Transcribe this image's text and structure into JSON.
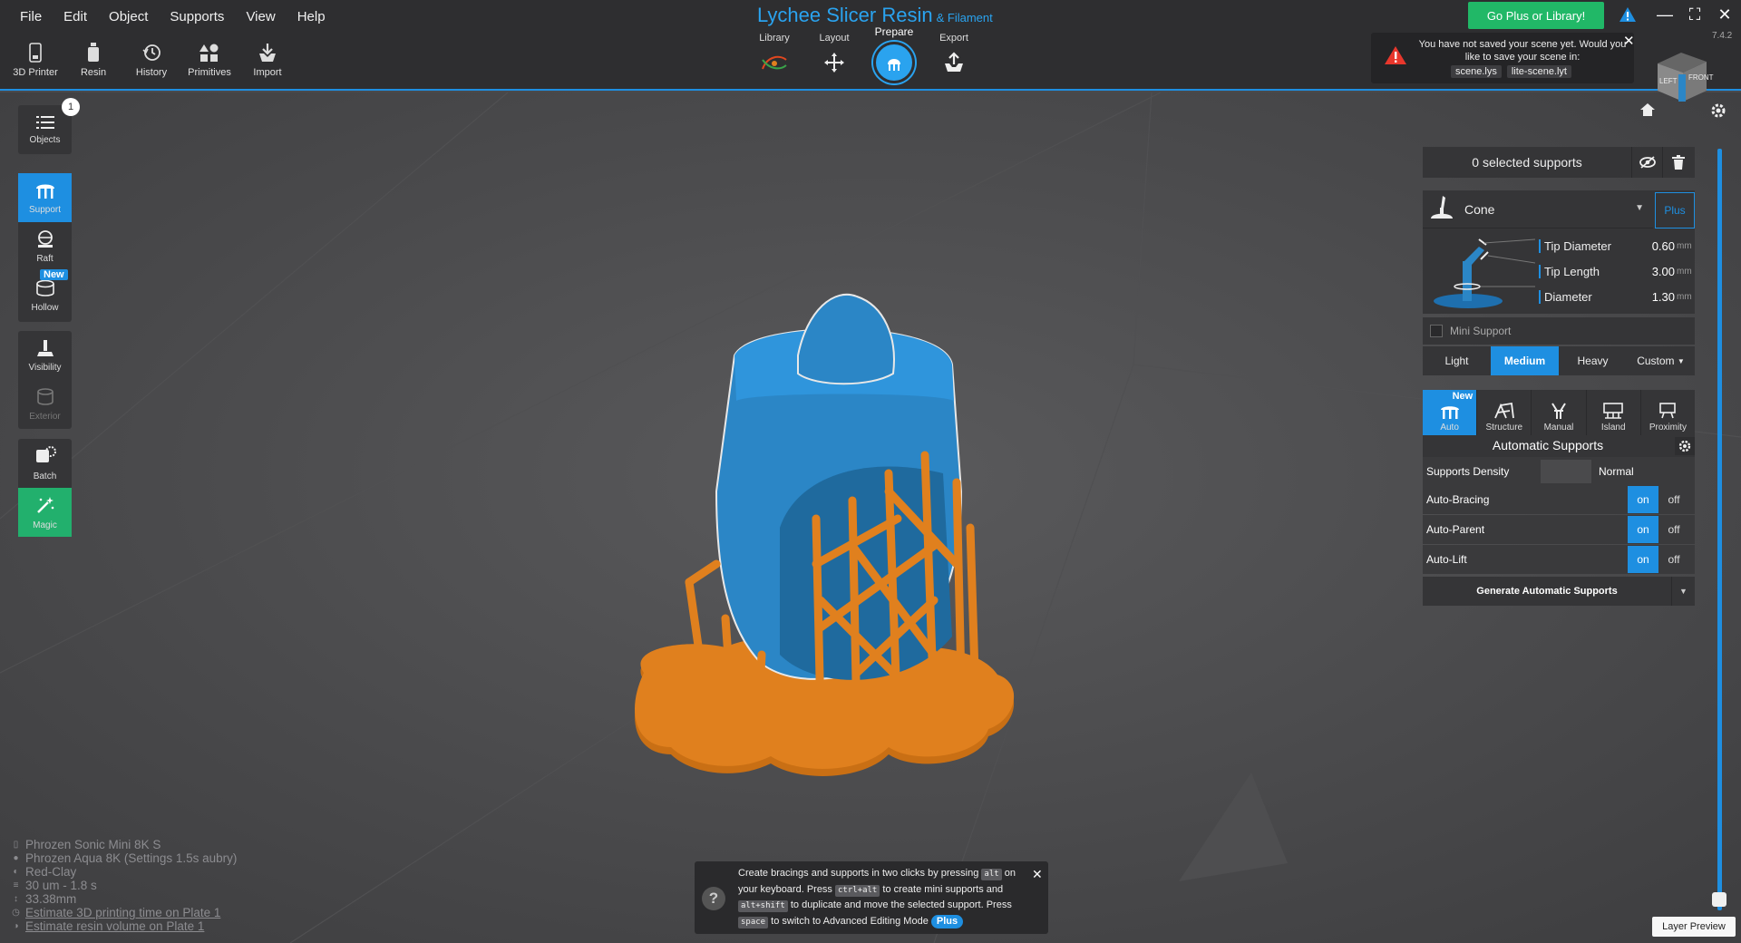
{
  "menu": [
    "File",
    "Edit",
    "Object",
    "Supports",
    "View",
    "Help"
  ],
  "app": {
    "title": "Lychee Slicer Resin",
    "subtitle": "& Filament",
    "version": "7.4.2"
  },
  "toolbar": [
    {
      "label": "3D Printer",
      "icon": "printer-icon"
    },
    {
      "label": "Resin",
      "icon": "resin-bottle-icon"
    },
    {
      "label": "History",
      "icon": "history-icon"
    },
    {
      "label": "Primitives",
      "icon": "primitives-icon"
    },
    {
      "label": "Import",
      "icon": "import-icon"
    }
  ],
  "steps": [
    {
      "label": "Library",
      "icon": "library-icon"
    },
    {
      "label": "Layout",
      "icon": "layout-move-icon"
    },
    {
      "label": "Prepare",
      "icon": "prepare-support-icon",
      "active": true
    },
    {
      "label": "Export",
      "icon": "export-icon"
    }
  ],
  "go_plus": "Go Plus or Library!",
  "save_notice": {
    "message": "You have not saved your scene yet. Would you like to save your scene in:",
    "file1": "scene.lys",
    "file2": "lite-scene.lyt"
  },
  "viewcube": {
    "left": "LEFT",
    "front": "FRONT"
  },
  "sidebar": {
    "objects": {
      "label": "Objects",
      "count": "1"
    },
    "support": "Support",
    "raft": "Raft",
    "hollow": "Hollow",
    "hollow_badge": "New",
    "visibility": "Visibility",
    "exterior": "Exterior",
    "batch": "Batch",
    "magic": "Magic"
  },
  "supports_panel": {
    "selected": "0 selected supports",
    "support_type": "Cone",
    "plus": "Plus",
    "params": [
      {
        "name": "Tip Diameter",
        "value": "0.60",
        "unit": "mm"
      },
      {
        "name": "Tip Length",
        "value": "3.00",
        "unit": "mm"
      },
      {
        "name": "Diameter",
        "value": "1.30",
        "unit": "mm"
      }
    ],
    "mini_support": "Mini Support",
    "presets": [
      "Light",
      "Medium",
      "Heavy",
      "Custom"
    ],
    "active_preset": "Medium",
    "modes": [
      {
        "label": "Auto",
        "badge": "New"
      },
      {
        "label": "Structure"
      },
      {
        "label": "Manual"
      },
      {
        "label": "Island"
      },
      {
        "label": "Proximity"
      }
    ],
    "auto_title": "Automatic Supports",
    "density_label": "Supports Density",
    "density_value": "Normal",
    "toggles": [
      {
        "label": "Auto-Bracing",
        "on": "on",
        "off": "off"
      },
      {
        "label": "Auto-Parent",
        "on": "on",
        "off": "off"
      },
      {
        "label": "Auto-Lift",
        "on": "on",
        "off": "off"
      }
    ],
    "generate": "Generate Automatic Supports"
  },
  "info": {
    "printer": "Phrozen Sonic Mini 8K S",
    "resin": "Phrozen Aqua 8K (Settings 1.5s aubry)",
    "color": "Red-Clay",
    "layers": "30 um - 1.8 s",
    "height": "33.38mm",
    "estimate_time": "Estimate 3D printing time on Plate 1",
    "estimate_resin": "Estimate resin volume on Plate 1"
  },
  "hint": {
    "p1": "Create bracings and supports in two clicks by pressing",
    "k1": "alt",
    "p2": "on your keyboard. Press",
    "k2": "ctrl+alt",
    "p3": "to create mini supports and",
    "k3": "alt+shift",
    "p4": "to duplicate and move the selected support. Press",
    "k4": "space",
    "p5": "to switch to Advanced Editing Mode",
    "plus": "Plus"
  },
  "layer_preview": "Layer Preview",
  "colors": {
    "accent": "#1e8fe1",
    "model": "#2b86c6",
    "supports": "#e0801e",
    "go_plus": "#21b867",
    "magic": "#22b06d"
  }
}
